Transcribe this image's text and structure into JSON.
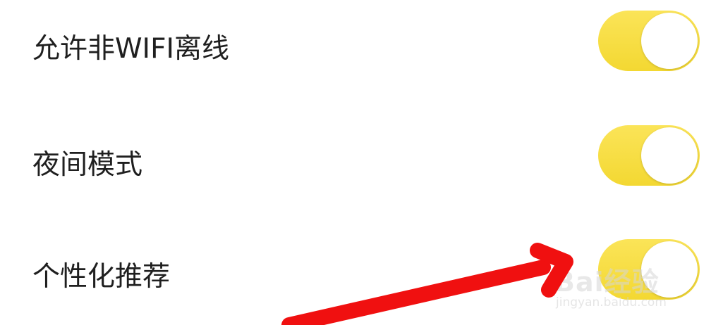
{
  "settings": {
    "items": [
      {
        "label": "允许非WIFI离线",
        "enabled": true
      },
      {
        "label": "夜间模式",
        "enabled": true
      },
      {
        "label": "个性化推荐",
        "enabled": true
      }
    ]
  },
  "colors": {
    "toggle_on": "#f6dc3c",
    "knob": "#ffffff",
    "label_text": "#1f1f1f",
    "annotation": "#f01010"
  },
  "watermark": {
    "brand": "Bai经验",
    "url": "jingyan.baidu.com"
  }
}
